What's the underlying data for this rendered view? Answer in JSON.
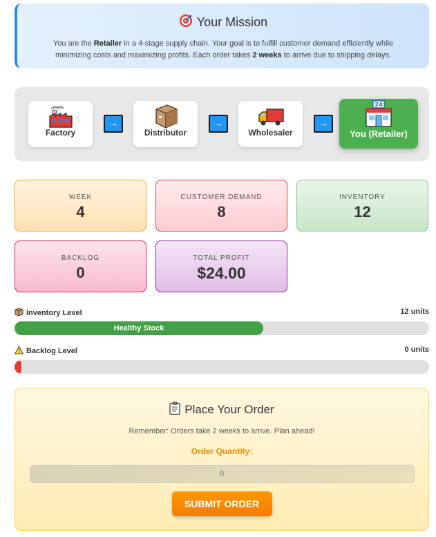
{
  "mission": {
    "title": "Your Mission",
    "icon": "target-icon",
    "text_1": "You are the ",
    "role": "Retailer",
    "text_2": " in a 4-stage supply chain. Your goal is to fulfill customer demand efficiently while minimizing costs and maximizing profits. Each order takes ",
    "delay": "2 weeks",
    "text_3": " to arrive due to shipping delays."
  },
  "chain": {
    "nodes": [
      {
        "label": "Factory",
        "icon": "factory-icon"
      },
      {
        "label": "Distributor",
        "icon": "package-icon"
      },
      {
        "label": "Wholesaler",
        "icon": "truck-icon"
      },
      {
        "label": "You (Retailer)",
        "icon": "store-icon"
      }
    ],
    "arrow": "→"
  },
  "stats": {
    "week": {
      "label": "WEEK",
      "value": "4"
    },
    "demand": {
      "label": "CUSTOMER DEMAND",
      "value": "8"
    },
    "inventory": {
      "label": "INVENTORY",
      "value": "12"
    },
    "backlog": {
      "label": "BACKLOG",
      "value": "0"
    },
    "profit": {
      "label": "TOTAL PROFIT",
      "value": "$24.00"
    }
  },
  "inventory_bar": {
    "label": "Inventory Level",
    "value_text": "12 units",
    "fill_text": "Healthy Stock",
    "fill_fraction": 0.6,
    "color": "#43a047"
  },
  "backlog_bar": {
    "label": "Backlog Level",
    "value_text": "0 units",
    "fill_fraction": 0.017,
    "color": "#e53935"
  },
  "order": {
    "title": "Place Your Order",
    "hint": "Remember: Orders take 2 weeks to arrive. Plan ahead!",
    "quantity_label": "Order Quantity:",
    "placeholder": "0",
    "submit_label": "SUBMIT ORDER"
  }
}
